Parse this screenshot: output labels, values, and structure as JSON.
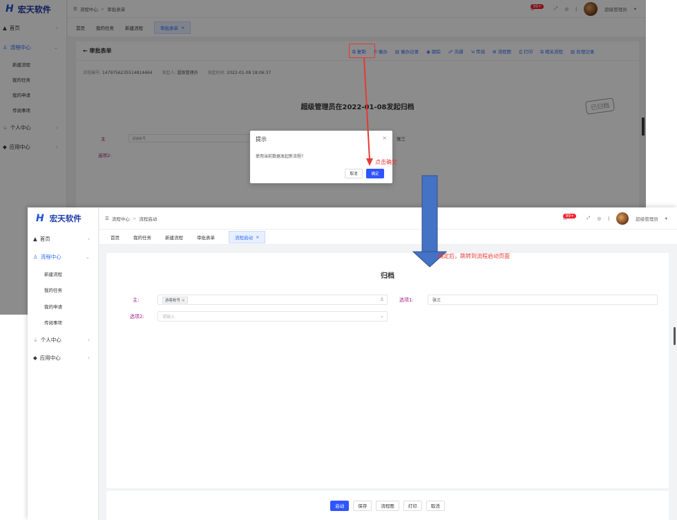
{
  "brand": {
    "name": "宏天软件",
    "mark": "H"
  },
  "sidebar": {
    "home": "首页",
    "process_center": "流程中心",
    "sub_items": [
      "新建流程",
      "我的任务",
      "我的申请",
      "传阅事项"
    ],
    "personal_center": "个人中心",
    "app_center": "应用中心"
  },
  "user": {
    "name": "超级管理员",
    "badge": "99+"
  },
  "top_screen": {
    "breadcrumb": [
      "流程中心",
      "审批表单"
    ],
    "tabs": [
      "首页",
      "我的任务",
      "新建流程",
      "审批表单"
    ],
    "active_tab": "审批表单",
    "form_title": "审批表单",
    "actions": [
      "复制",
      "催办",
      "催办记录",
      "跟踪",
      "沟通",
      "传阅",
      "流程图",
      "打印",
      "相关流程",
      "处理记录"
    ],
    "meta": {
      "no_label": "流程编号:",
      "no_value": "1479756235514814464",
      "starter_label": "发起人:",
      "starter_value": "超级管理员",
      "time_label": "发起时间:",
      "time_value": "2022-01-08 18:06:37"
    },
    "doc_title": "超级管理员在2022-01-08发起归档",
    "stamp": "已归档",
    "field_main_label": "主",
    "field_main_placeholder": "请输帐号",
    "field_opt1_value": "张三",
    "field_opt2_label": "选项2:",
    "dialog": {
      "title": "提示",
      "message": "使用当前数据发起新流程?",
      "cancel": "取消",
      "ok": "确定"
    },
    "note": "点击确定"
  },
  "bottom_screen": {
    "breadcrumb": [
      "流程中心",
      "流程启动"
    ],
    "tabs": [
      "首页",
      "我的任务",
      "新建流程",
      "审批表单",
      "流程启动"
    ],
    "active_tab": "流程启动",
    "title": "归档",
    "field_main_label": "主:",
    "field_main_tag": "游客帐号",
    "field_opt1_label": "选项1:",
    "field_opt1_value": "张三",
    "field_opt2_label": "选项2:",
    "field_opt2_placeholder": "请输入",
    "buttons": [
      "启动",
      "保存",
      "流程图",
      "打印",
      "取消"
    ],
    "note": "确定后，跳转到流程启动页面"
  },
  "colors": {
    "accent": "#2f6bff",
    "annotation_red": "#e53935",
    "arrow_blue": "#4472c4"
  },
  "icons": [
    "menu-icon",
    "home-icon",
    "process-icon",
    "user-icon",
    "app-icon",
    "message-icon",
    "fullscreen-icon",
    "settings-icon",
    "close-icon",
    "chevron-down-icon",
    "chevron-right-icon",
    "person-select-icon"
  ]
}
